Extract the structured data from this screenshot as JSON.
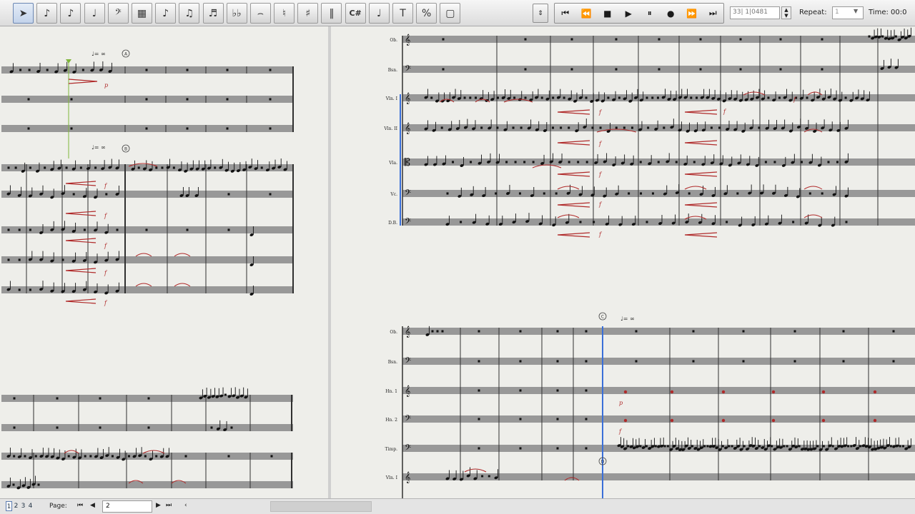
{
  "toolbar": {
    "tools": [
      {
        "name": "select-arrow-icon",
        "glyph": "➤",
        "active": true
      },
      {
        "name": "note-entry-icon",
        "glyph": "♪"
      },
      {
        "name": "staccato-icon",
        "glyph": "♪"
      },
      {
        "name": "slur-icon",
        "glyph": "♩"
      },
      {
        "name": "clef-icon",
        "glyph": "𝄢"
      },
      {
        "name": "key-signature-icon",
        "glyph": "▦"
      },
      {
        "name": "eighth-note-icon",
        "glyph": "♪"
      },
      {
        "name": "beam-icon",
        "glyph": "♫"
      },
      {
        "name": "ledger-icon",
        "glyph": "♬"
      },
      {
        "name": "tuplet-icon",
        "glyph": "♭♭"
      },
      {
        "name": "tie-icon",
        "glyph": "⌢"
      },
      {
        "name": "articulation-icon",
        "glyph": "♮"
      },
      {
        "name": "chord-icon",
        "glyph": "♯"
      },
      {
        "name": "measure-icon",
        "glyph": "‖"
      },
      {
        "name": "chord-symbol-icon",
        "glyph": "C#",
        "small": true
      },
      {
        "name": "lyrics-icon",
        "glyph": "♩"
      },
      {
        "name": "text-icon",
        "glyph": "T"
      },
      {
        "name": "percent-icon",
        "glyph": "%"
      },
      {
        "name": "page-icon",
        "glyph": "▢"
      }
    ],
    "transport": [
      {
        "name": "rewind-to-start-icon",
        "glyph": "⏮"
      },
      {
        "name": "rewind-icon",
        "glyph": "⏪"
      },
      {
        "name": "stop-icon",
        "glyph": "■"
      },
      {
        "name": "play-icon",
        "glyph": "▶"
      },
      {
        "name": "pause-icon",
        "glyph": "⏸"
      },
      {
        "name": "record-icon",
        "glyph": "●"
      },
      {
        "name": "fast-forward-icon",
        "glyph": "⏩"
      },
      {
        "name": "forward-to-end-icon",
        "glyph": "⏭"
      }
    ],
    "position_value": "33| 1|0481",
    "repeat_label": "Repeat:",
    "repeat_value": "1",
    "time_label": "Time:",
    "time_value": "00:0"
  },
  "score": {
    "left_system_1_instruments": [
      "",
      "",
      ""
    ],
    "left_system_2_instruments": [
      "",
      "",
      "",
      "",
      ""
    ],
    "right_system_1_instruments": [
      "Ob.",
      "Bsn.",
      "Vln. I",
      "Vln. II",
      "Vla.",
      "Vc.",
      "D.B."
    ],
    "right_system_2_instruments": [
      "Ob.",
      "Bsn.",
      "Hn. 1",
      "Hn. 2",
      "Timp.",
      "Vln. I"
    ],
    "tempo_marks": [
      "♩= ∞",
      "♩= ∞",
      "♩= ∞"
    ],
    "rehearsal_marks": [
      "A",
      "B",
      "C",
      "D"
    ],
    "dynamics": [
      "f",
      "f",
      "f",
      "f",
      "p"
    ],
    "colors": {
      "paper": "#eeeeea",
      "staff": "#a8a8a8",
      "staff_line": "#303030",
      "note": "#111111",
      "hairpin": "#b02a2a",
      "selection": "#3a6fd8",
      "cursor": "#7fb53a"
    }
  },
  "bottombar": {
    "page_tabs": [
      "1",
      "2",
      "3",
      "4"
    ],
    "page_label": "Page:",
    "page_value": "2"
  }
}
